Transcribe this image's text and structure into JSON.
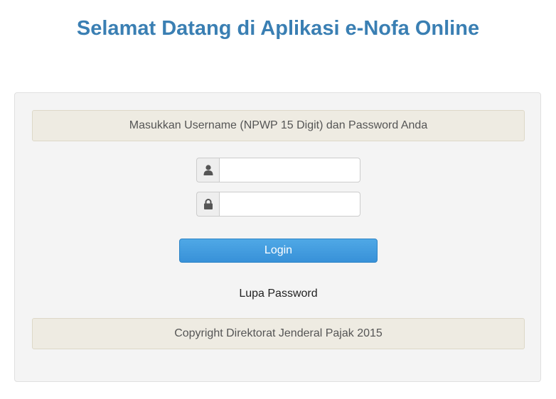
{
  "header": {
    "title": "Selamat Datang di Aplikasi e-Nofa Online"
  },
  "login_form": {
    "instruction": "Masukkan Username (NPWP 15 Digit) dan Password Anda",
    "username": {
      "value": "",
      "placeholder": "",
      "icon": "user-icon"
    },
    "password": {
      "value": "",
      "placeholder": "",
      "icon": "lock-icon"
    },
    "login_label": "Login",
    "forgot_label": "Lupa Password",
    "copyright": "Copyright Direktorat Jenderal Pajak 2015"
  },
  "colors": {
    "title": "#3a7fb3",
    "button": "#3891d8",
    "notice_bg": "#eeebe2",
    "panel_bg": "#f4f4f4"
  }
}
